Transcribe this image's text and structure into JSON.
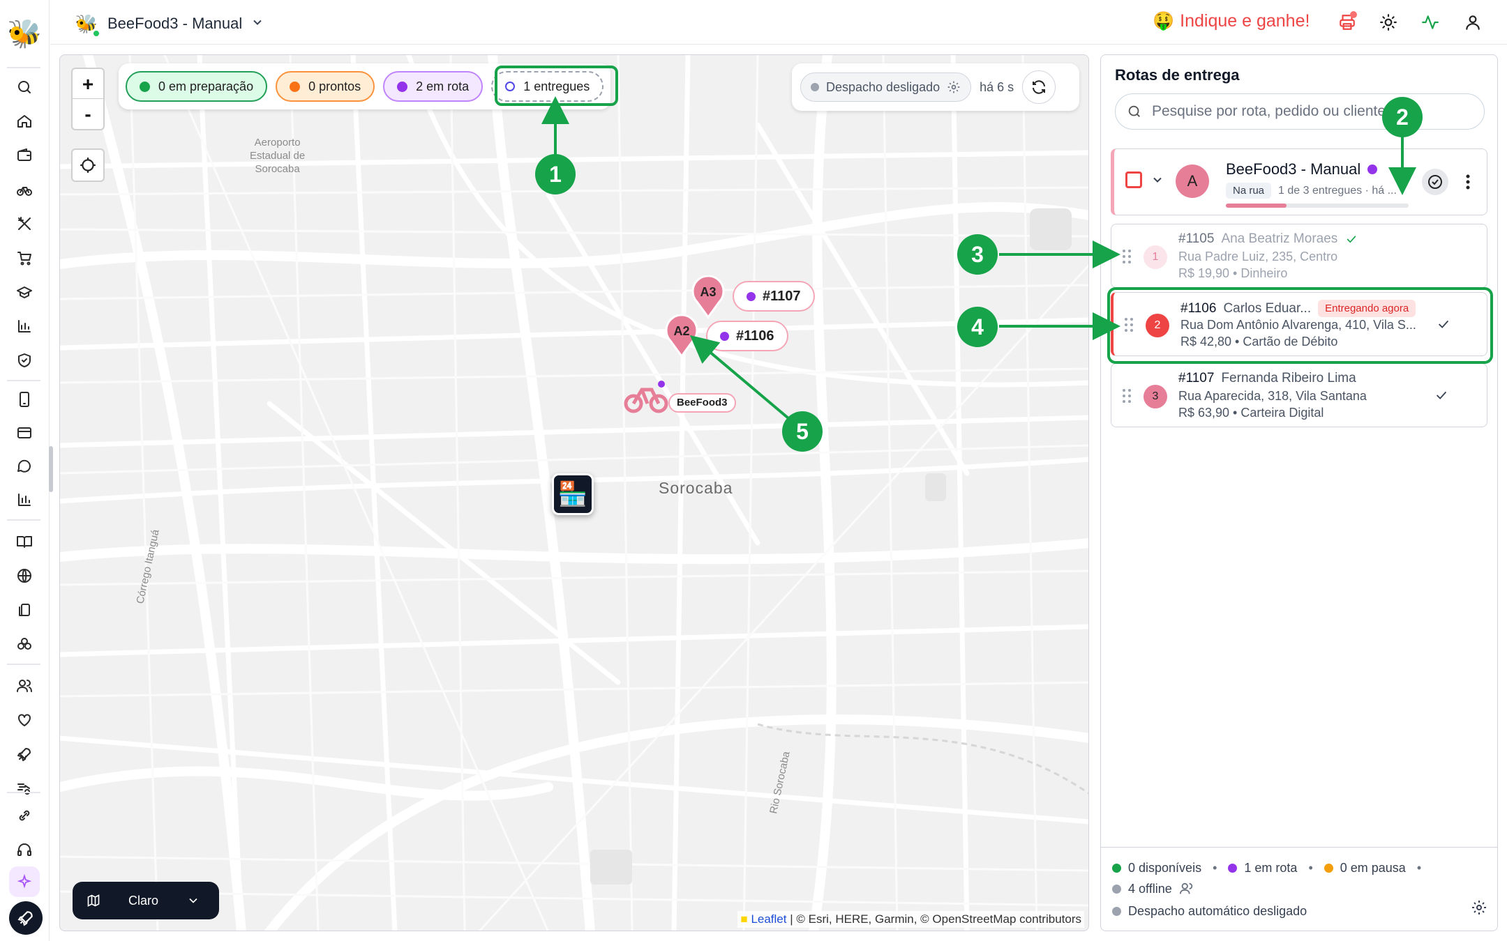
{
  "app": {
    "logo_icon": "bee-logo-icon",
    "store_name": "BeeFood3 - Manual",
    "promo_text": "Indique e ganhe!",
    "promo_emoji": "🤑"
  },
  "sidebar": {
    "icons": [
      "search-icon",
      "home-icon",
      "wallet-icon",
      "bike-icon",
      "utensils-icon",
      "cart-icon",
      "box-icon",
      "chart-icon",
      "shield-icon",
      "phone-icon",
      "card-icon",
      "chat-icon",
      "bar-chart-icon",
      "book-icon",
      "globe-icon",
      "copy-icon",
      "boxes-icon",
      "users-icon",
      "heart-icon",
      "rocket-icon",
      "delivery-icon",
      "link-icon",
      "headset-icon",
      "sparkle-icon",
      "rocket-icon"
    ]
  },
  "map": {
    "filters": [
      {
        "label": "0 em preparação",
        "color": "#16a34a"
      },
      {
        "label": "0 prontos",
        "color": "#f97316"
      },
      {
        "label": "2 em rota",
        "color": "#9333ea"
      },
      {
        "label": "1 entregues",
        "color": "#4f46e5"
      }
    ],
    "dispatch_label": "Despacho desligado",
    "updated_ago": "há 6 s",
    "zoom_in": "+",
    "zoom_out": "-",
    "airport_label": "Aeroporto\nEstadual de\nSorocaba",
    "city_label": "Sorocaba",
    "street_1": "Córrego Itanguá",
    "street_2": "Rio Sorocaba",
    "pins": [
      {
        "label": "A3",
        "order": "#1107"
      },
      {
        "label": "A2",
        "order": "#1106"
      }
    ],
    "courier_label": "BeeFood3",
    "theme_label": "Claro",
    "attribution_link": "Leaflet",
    "attribution_text": "| © Esri, HERE, Garmin, © OpenStreetMap contributors"
  },
  "panel": {
    "title": "Rotas de entrega",
    "search_placeholder": "Pesquise por rota, pedido ou cliente",
    "route": {
      "avatar": "A",
      "name": "BeeFood3 - Manual",
      "status_tag": "Na rua",
      "status_text": "1 de 3 entregues · há ...",
      "progress": 0.3333
    },
    "stops": [
      {
        "num": "1",
        "order": "#1105",
        "customer": "Ana Beatriz Moraes",
        "address": "Rua Padre Luiz, 235, Centro",
        "payment": "R$ 19,90 • Dinheiro",
        "live": ""
      },
      {
        "num": "2",
        "order": "#1106",
        "customer": "Carlos Eduar...",
        "address": "Rua Dom Antônio Alvarenga, 410, Vila S...",
        "payment": "R$ 42,80 • Cartão de Débito",
        "live": "Entregando agora"
      },
      {
        "num": "3",
        "order": "#1107",
        "customer": "Fernanda Ribeiro Lima",
        "address": "Rua Aparecida, 318, Vila Santana",
        "payment": "R$ 63,90 • Carteira Digital",
        "live": ""
      }
    ],
    "footer": {
      "available": "0 disponíveis",
      "on_route": "1 em rota",
      "paused": "0 em pausa",
      "offline": "4 offline",
      "auto_dispatch": "Despacho automático desligado"
    }
  },
  "annotations": [
    "1",
    "2",
    "3",
    "4",
    "5"
  ]
}
